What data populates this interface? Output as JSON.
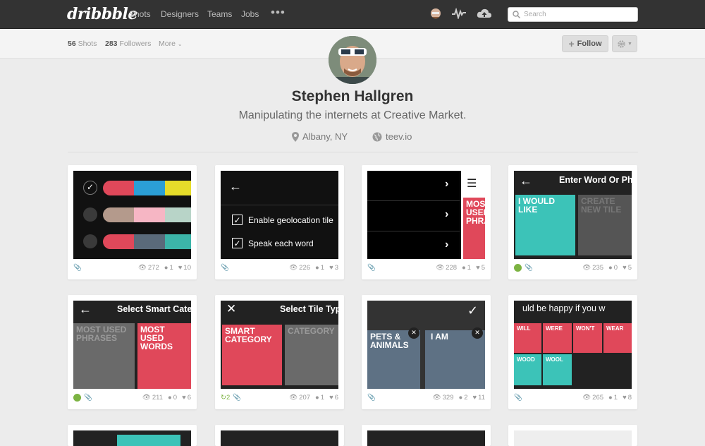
{
  "header": {
    "logo": "dribbble",
    "nav": [
      "Shots",
      "Designers",
      "Teams",
      "Jobs"
    ],
    "more_dots": "•••",
    "search_placeholder": "Search"
  },
  "profile_bar": {
    "shots_count": "56",
    "shots_label": "Shots",
    "followers_count": "283",
    "followers_label": "Followers",
    "more_label": "More",
    "follow_label": "Follow"
  },
  "profile": {
    "name": "Stephen Hallgren",
    "bio": "Manipulating the internets at Creative Market.",
    "location": "Albany, NY",
    "website": "teev.io"
  },
  "shots": [
    {
      "views": "272",
      "comments": "1",
      "likes": "10",
      "rebounds": "",
      "has_rebound_icon": false
    },
    {
      "views": "226",
      "comments": "1",
      "likes": "3",
      "rebounds": "",
      "has_rebound_icon": false
    },
    {
      "views": "228",
      "comments": "1",
      "likes": "5",
      "rebounds": "",
      "has_rebound_icon": false
    },
    {
      "views": "235",
      "comments": "0",
      "likes": "5",
      "rebounds": "",
      "has_rebound_icon": true
    },
    {
      "views": "211",
      "comments": "0",
      "likes": "6",
      "rebounds": "",
      "has_rebound_icon": true
    },
    {
      "views": "207",
      "comments": "1",
      "likes": "6",
      "rebounds": "2",
      "has_rebound_icon": false
    },
    {
      "views": "329",
      "comments": "2",
      "likes": "11",
      "rebounds": "",
      "has_rebound_icon": false
    },
    {
      "views": "265",
      "comments": "1",
      "likes": "8",
      "rebounds": "",
      "has_rebound_icon": false
    }
  ],
  "thumbs": {
    "t2_item1": "Enable geolocation tile",
    "t2_item2": "Speak each word",
    "t3_tile": "MOST USED PHRASES",
    "t4_title": "Enter Word Or Phrase",
    "t4_tile1": "I WOULD LIKE",
    "t4_tile2": "CREATE NEW TILE",
    "t5_title": "Select Smart Category",
    "t5_tile1": "MOST USED PHRASES",
    "t5_tile2": "MOST USED WORDS",
    "t6_title": "Select Tile Type",
    "t6_tile1": "SMART CATEGORY",
    "t6_tile2": "CATEGORY",
    "t7_tile1": "PETS & ANIMALS",
    "t7_tile2": "I AM",
    "t8_text": "uld be happy if you w",
    "t8_words": [
      "WILL",
      "WERE",
      "WON'T",
      "WEAR",
      "WOOD",
      "WOOL"
    ]
  },
  "colors": {
    "topbar": "#333333",
    "red": "#e0485a",
    "teal": "#3cc3b8",
    "grey_tile": "#6a6a6a",
    "slate": "#5e7184"
  }
}
